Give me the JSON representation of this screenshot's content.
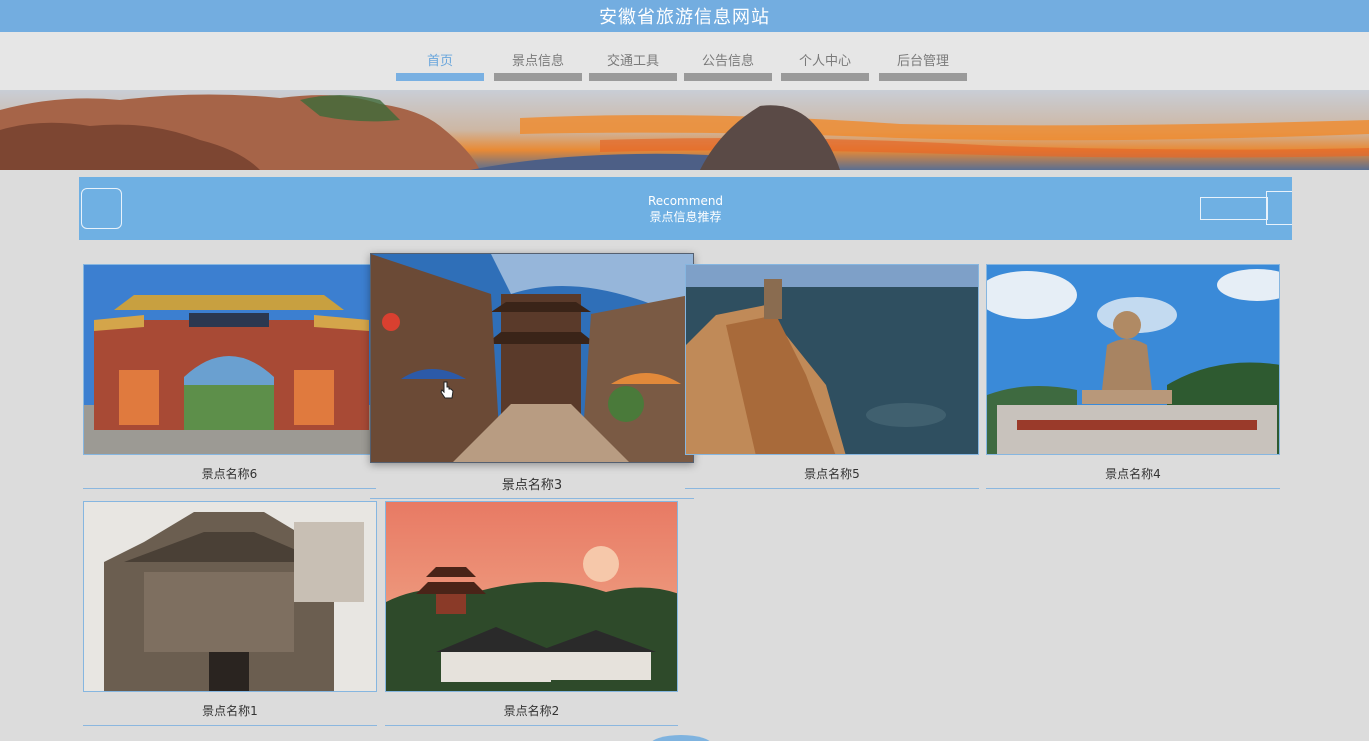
{
  "header": {
    "title": "安徽省旅游信息网站"
  },
  "nav": {
    "items": [
      {
        "label": "首页",
        "active": true
      },
      {
        "label": "景点信息",
        "active": false
      },
      {
        "label": "交通工具",
        "active": false
      },
      {
        "label": "公告信息",
        "active": false
      },
      {
        "label": "个人中心",
        "active": false
      },
      {
        "label": "后台管理",
        "active": false
      }
    ]
  },
  "recommend": {
    "title_en": "Recommend",
    "title_cn": "景点信息推荐"
  },
  "cards": [
    {
      "name": "景点名称6",
      "image": "memorial-archway-photo"
    },
    {
      "name": "景点名称3",
      "image": "ancient-town-street-photo"
    },
    {
      "name": "景点名称5",
      "image": "sea-cliff-photo"
    },
    {
      "name": "景点名称4",
      "image": "buddha-statue-photo"
    },
    {
      "name": "景点名称1",
      "image": "carved-stone-gate-photo"
    },
    {
      "name": "景点名称2",
      "image": "pagoda-sunset-photo"
    }
  ],
  "colors": {
    "accent": "#73ade0",
    "nav_inactive": "#9a9a9a",
    "background": "#dcdcdc"
  }
}
